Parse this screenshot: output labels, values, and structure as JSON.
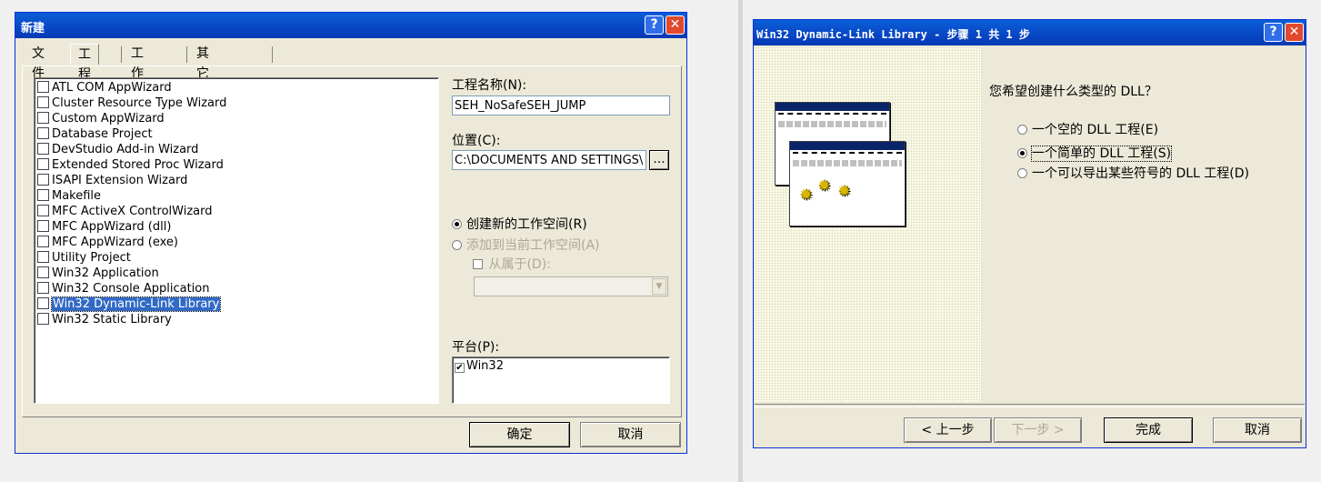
{
  "left_dialog": {
    "title": "新建",
    "tabs": [
      "文件",
      "工程",
      "工作区",
      "其它文档"
    ],
    "project_types": [
      "ATL COM AppWizard",
      "Cluster Resource Type Wizard",
      "Custom AppWizard",
      "Database Project",
      "DevStudio Add-in Wizard",
      "Extended Stored Proc Wizard",
      "ISAPI Extension Wizard",
      "Makefile",
      "MFC ActiveX ControlWizard",
      "MFC AppWizard (dll)",
      "MFC AppWizard (exe)",
      "Utility Project",
      "Win32 Application",
      "Win32 Console Application",
      "Win32 Dynamic-Link Library",
      "Win32 Static Library"
    ],
    "selected_project": "Win32 Dynamic-Link Library",
    "project_name_label": "工程名称(N):",
    "project_name_value": "SEH_NoSafeSEH_JUMP",
    "location_label": "位置(C):",
    "location_value": "C:\\DOCUMENTS AND SETTINGS\\",
    "browse_label": "...",
    "radio_create_new": "创建新的工作空间(R)",
    "radio_add_current": "添加到当前工作空间(A)",
    "checkbox_depends": "从属于(D):",
    "platform_label": "平台(P):",
    "platform_item": "Win32",
    "ok_label": "确定",
    "cancel_label": "取消"
  },
  "right_dialog": {
    "title": "Win32 Dynamic-Link Library - 步骤 1 共 1 步",
    "question": "您希望创建什么类型的 DLL？",
    "options": [
      "一个空的 DLL 工程(E)",
      "一个简单的 DLL 工程(S)",
      "一个可以导出某些符号的 DLL 工程(D)"
    ],
    "selected_option": "一个简单的 DLL 工程(S)",
    "back_label": "< 上一步",
    "next_label": "下一步 >",
    "finish_label": "完成",
    "cancel_label": "取消"
  },
  "title_buttons": {
    "help": "?",
    "close": "✕"
  },
  "colors": {
    "title_bar": "#0846c4",
    "selection": "#316ac5",
    "dialog_bg": "#ece9d8"
  }
}
